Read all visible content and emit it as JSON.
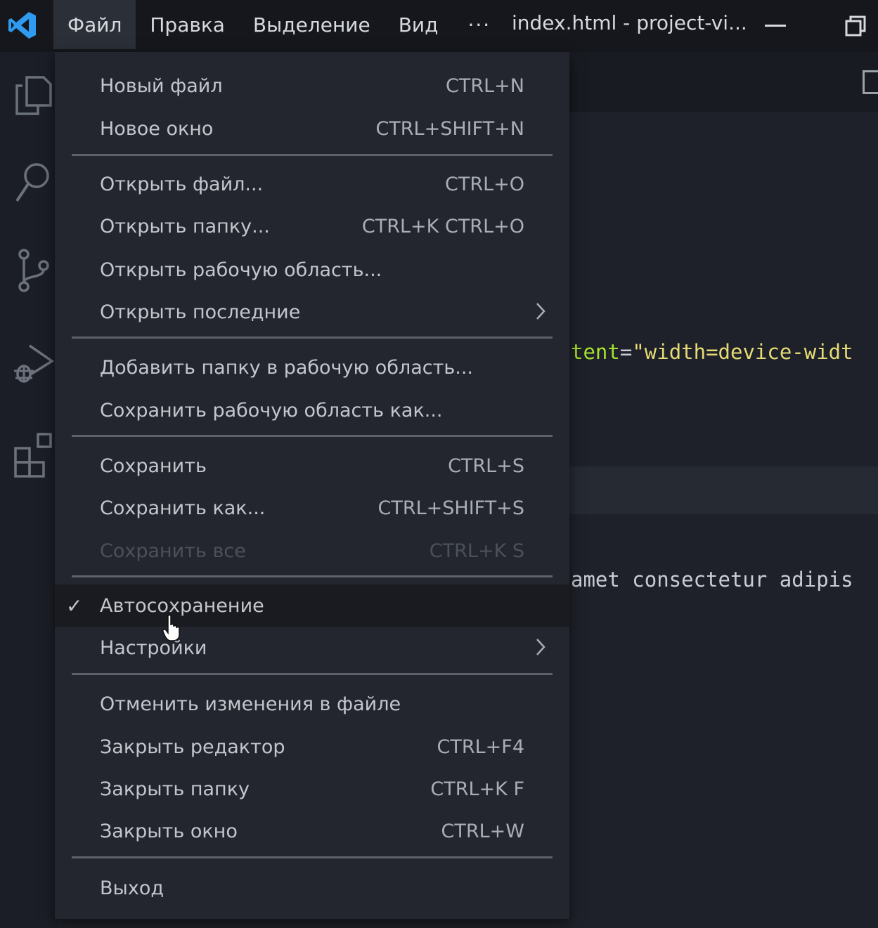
{
  "titlebar": {
    "menus": [
      "Файл",
      "Правка",
      "Выделение",
      "Вид"
    ],
    "more": "···",
    "window_title": "index.html - project-vi...",
    "brand_color": "#2f9bf0"
  },
  "activitybar": {
    "icons": [
      "explorer-icon",
      "search-icon",
      "source-control-icon",
      "run-debug-icon",
      "extensions-icon"
    ]
  },
  "editor": {
    "line1": {
      "attr": "tent",
      "eq": "=",
      "str": "\"width=device-widt"
    },
    "line2": {
      "text": "amet consectetur adipis"
    }
  },
  "file_menu": {
    "items": [
      {
        "label": "Новый файл",
        "key": "CTRL+N"
      },
      {
        "label": "Новое окно",
        "key": "CTRL+SHIFT+N"
      },
      {
        "label": "Открыть файл...",
        "key": "CTRL+O"
      },
      {
        "label": "Открыть папку...",
        "key": "CTRL+K CTRL+O"
      },
      {
        "label": "Открыть рабочую область...",
        "key": ""
      },
      {
        "label": "Открыть последние",
        "key": ""
      },
      {
        "label": "Добавить папку в рабочую область...",
        "key": ""
      },
      {
        "label": "Сохранить рабочую область как...",
        "key": ""
      },
      {
        "label": "Сохранить",
        "key": "CTRL+S"
      },
      {
        "label": "Сохранить как...",
        "key": "CTRL+SHIFT+S"
      },
      {
        "label": "Сохранить все",
        "key": "CTRL+K S",
        "disabled": true
      },
      {
        "label": "Автосохранение",
        "key": "",
        "checked": true,
        "check": "✓"
      },
      {
        "label": "Настройки",
        "key": ""
      },
      {
        "label": "Отменить изменения в файле",
        "key": ""
      },
      {
        "label": "Закрыть редактор",
        "key": "CTRL+F4"
      },
      {
        "label": "Закрыть папку",
        "key": "CTRL+K F"
      },
      {
        "label": "Закрыть окно",
        "key": "CTRL+W"
      },
      {
        "label": "Выход",
        "key": ""
      }
    ]
  }
}
